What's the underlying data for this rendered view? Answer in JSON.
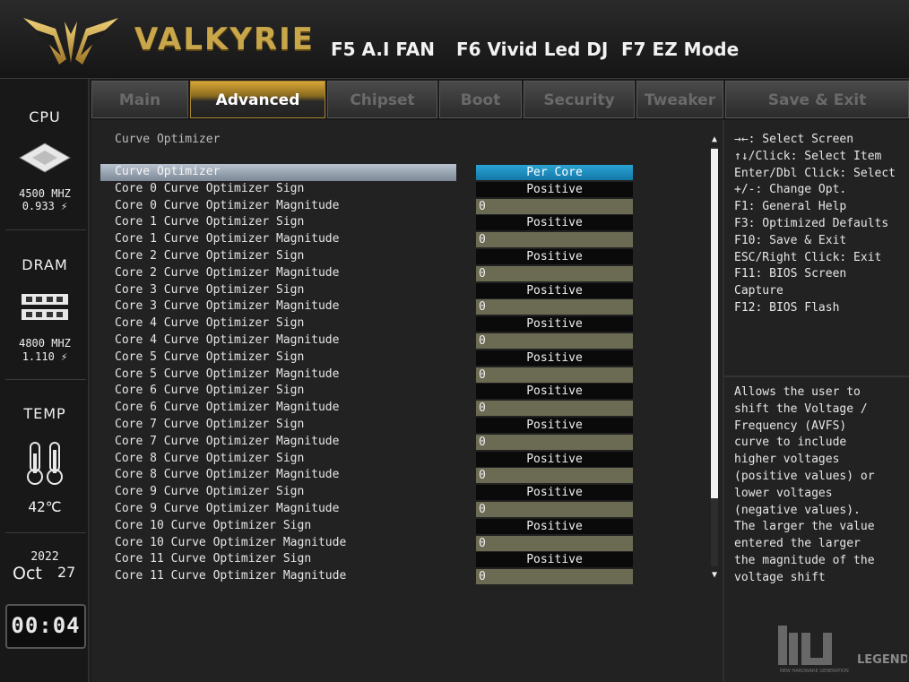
{
  "header": {
    "brand": "VALKYRIE",
    "hotkeys": [
      "F5 A.I FAN",
      "F6 Vivid Led DJ",
      "F7 EZ Mode"
    ]
  },
  "sidebar": {
    "cpu": {
      "title": "CPU",
      "freq": "4500 MHZ",
      "volt": "0.933 ⚡"
    },
    "dram": {
      "title": "DRAM",
      "freq": "4800 MHZ",
      "volt": "1.110 ⚡"
    },
    "temp": {
      "title": "TEMP",
      "value": "42℃"
    },
    "date": {
      "year": "2022",
      "month": "Oct",
      "day": "27"
    },
    "clock": "00:04"
  },
  "tabs": [
    "Main",
    "Advanced",
    "Chipset",
    "Boot",
    "Security",
    "Tweaker",
    "Save & Exit"
  ],
  "active_tab": "Advanced",
  "main": {
    "section_title": "Curve Optimizer",
    "rows": [
      {
        "label": "Curve Optimizer",
        "value": "Per Core",
        "kind": "select-active"
      },
      {
        "label": "Core 0 Curve Optimizer Sign",
        "value": "Positive",
        "kind": "select"
      },
      {
        "label": "Core 0 Curve Optimizer Magnitude",
        "value": "0",
        "kind": "num"
      },
      {
        "label": "Core 1 Curve Optimizer Sign",
        "value": "Positive",
        "kind": "select"
      },
      {
        "label": "Core 1 Curve Optimizer Magnitude",
        "value": "0",
        "kind": "num"
      },
      {
        "label": "Core 2 Curve Optimizer Sign",
        "value": "Positive",
        "kind": "select"
      },
      {
        "label": "Core 2 Curve Optimizer Magnitude",
        "value": "0",
        "kind": "num"
      },
      {
        "label": "Core 3 Curve Optimizer Sign",
        "value": "Positive",
        "kind": "select"
      },
      {
        "label": "Core 3 Curve Optimizer Magnitude",
        "value": "0",
        "kind": "num"
      },
      {
        "label": "Core 4 Curve Optimizer Sign",
        "value": "Positive",
        "kind": "select"
      },
      {
        "label": "Core 4 Curve Optimizer Magnitude",
        "value": "0",
        "kind": "num"
      },
      {
        "label": "Core 5 Curve Optimizer Sign",
        "value": "Positive",
        "kind": "select"
      },
      {
        "label": "Core 5 Curve Optimizer Magnitude",
        "value": "0",
        "kind": "num"
      },
      {
        "label": "Core 6 Curve Optimizer Sign",
        "value": "Positive",
        "kind": "select"
      },
      {
        "label": "Core 6 Curve Optimizer Magnitude",
        "value": "0",
        "kind": "num"
      },
      {
        "label": "Core 7 Curve Optimizer Sign",
        "value": "Positive",
        "kind": "select"
      },
      {
        "label": "Core 7 Curve Optimizer Magnitude",
        "value": "0",
        "kind": "num"
      },
      {
        "label": "Core 8 Curve Optimizer Sign",
        "value": "Positive",
        "kind": "select"
      },
      {
        "label": "Core 8 Curve Optimizer Magnitude",
        "value": "0",
        "kind": "num"
      },
      {
        "label": "Core 9 Curve Optimizer Sign",
        "value": "Positive",
        "kind": "select"
      },
      {
        "label": "Core 9 Curve Optimizer Magnitude",
        "value": "0",
        "kind": "num"
      },
      {
        "label": "Core 10 Curve Optimizer Sign",
        "value": "Positive",
        "kind": "select"
      },
      {
        "label": "Core 10 Curve Optimizer Magnitude",
        "value": "0",
        "kind": "num"
      },
      {
        "label": "Core 11 Curve Optimizer Sign",
        "value": "Positive",
        "kind": "select"
      },
      {
        "label": "Core 11 Curve Optimizer Magnitude",
        "value": "0",
        "kind": "num"
      }
    ]
  },
  "help": {
    "keys": [
      "→←: Select Screen",
      "↑↓/Click: Select Item",
      "Enter/Dbl Click: Select",
      "+/-: Change Opt.",
      "F1: General Help",
      "F3: Optimized Defaults",
      "F10: Save & Exit",
      "ESC/Right Click: Exit",
      "F11: BIOS Screen",
      "Capture",
      "F12: BIOS Flash"
    ],
    "description": [
      "Allows the user to",
      "shift the Voltage /",
      "Frequency (AVFS)",
      "curve to include",
      "higher voltages",
      "(positive values) or",
      "lower voltages",
      "(negative values).",
      "The larger the value",
      "entered the larger",
      "the magnitude of the",
      "voltage shift"
    ]
  },
  "watermark": {
    "text": "LEGEND",
    "tagline": "NEW HARDWARE GENERATION"
  },
  "colors": {
    "accent_gold": "#c9a64a",
    "active_select": "#1f8fc0",
    "magnitude_field": "#6b6a52",
    "selected_row": "#9aa5b1"
  }
}
